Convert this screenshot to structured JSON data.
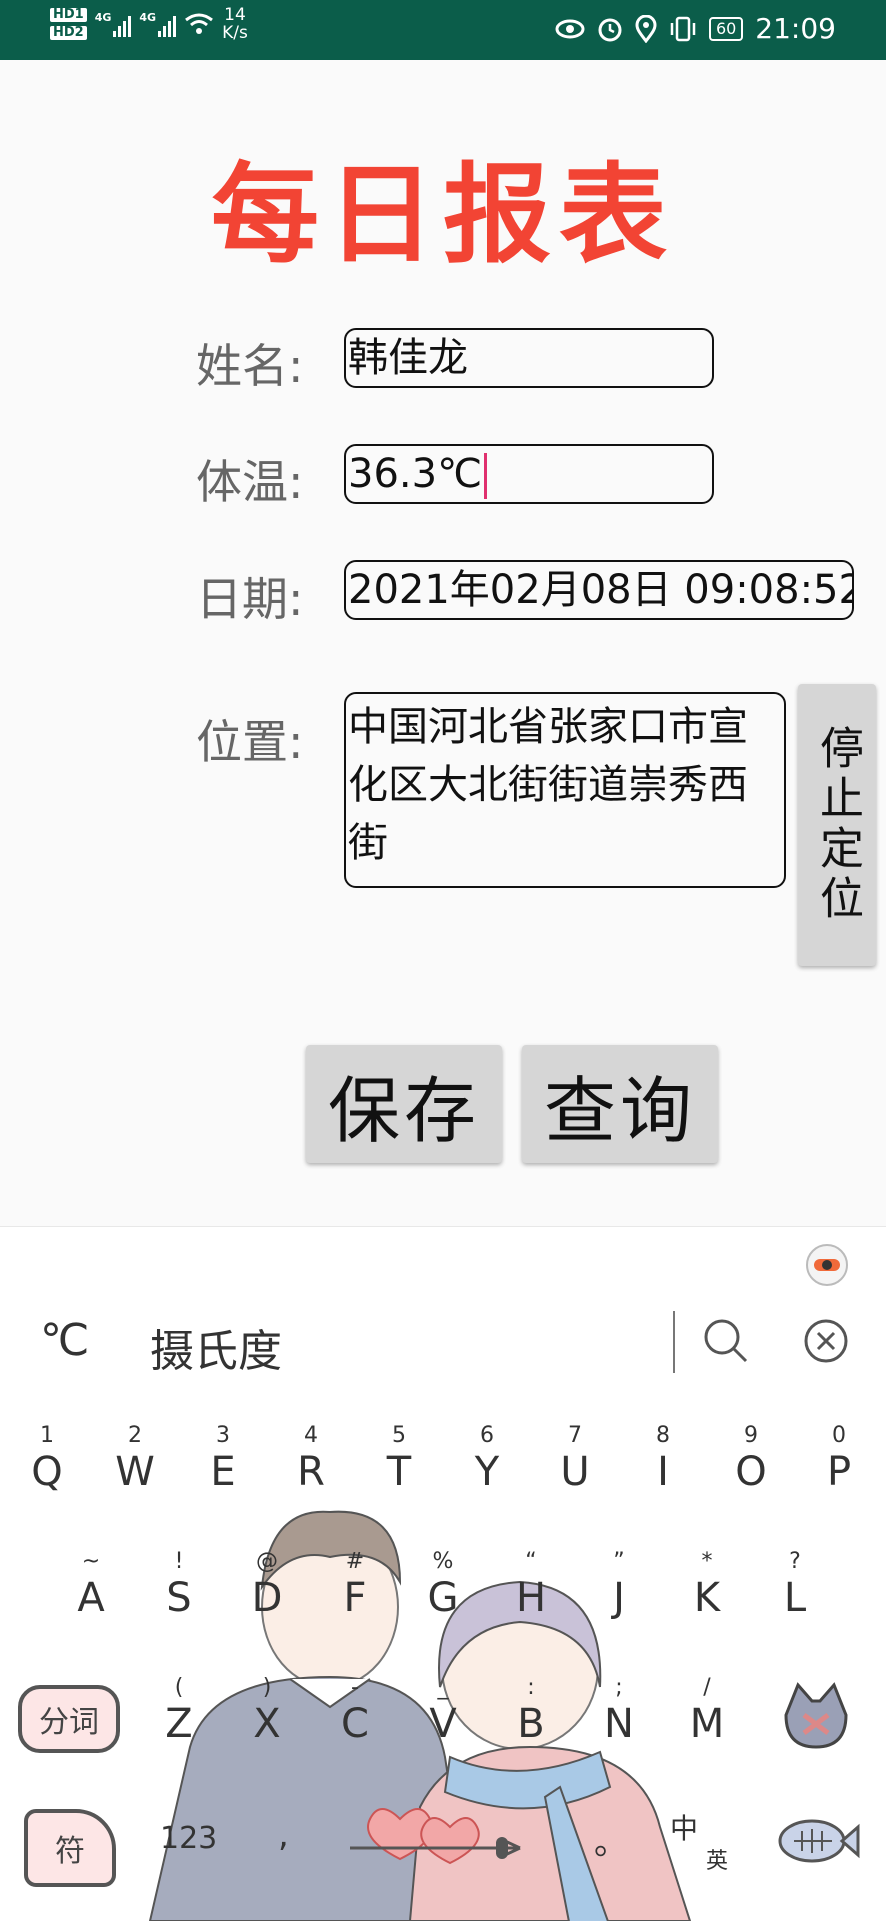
{
  "status_bar": {
    "sim1": "HD1",
    "sim2": "HD2",
    "net1": "4G",
    "net2": "4G",
    "speed_value": "14",
    "speed_unit": "K/s",
    "battery": "60",
    "time": "21:09"
  },
  "page": {
    "title": "每日报表"
  },
  "form": {
    "name_label": "姓名:",
    "name_value": "韩佳龙",
    "temp_label": "体温:",
    "temp_value": "36.3℃",
    "date_label": "日期:",
    "date_value": "2021年02月08日 09:08:52",
    "loc_label": "位置:",
    "loc_value": "中国河北省张家口市宣化区大北街街道崇秀西街",
    "stop_location_label": "停止定位"
  },
  "actions": {
    "save_label": "保存",
    "query_label": "查询"
  },
  "keyboard": {
    "candidates": [
      "℃",
      "摄氏度"
    ],
    "row1": [
      {
        "num": "1",
        "letter": "Q"
      },
      {
        "num": "2",
        "letter": "W"
      },
      {
        "num": "3",
        "letter": "E"
      },
      {
        "num": "4",
        "letter": "R"
      },
      {
        "num": "5",
        "letter": "T"
      },
      {
        "num": "6",
        "letter": "Y"
      },
      {
        "num": "7",
        "letter": "U"
      },
      {
        "num": "8",
        "letter": "I"
      },
      {
        "num": "9",
        "letter": "O"
      },
      {
        "num": "0",
        "letter": "P"
      }
    ],
    "row2": [
      {
        "num": "~",
        "letter": "A"
      },
      {
        "num": "!",
        "letter": "S"
      },
      {
        "num": "@",
        "letter": "D"
      },
      {
        "num": "#",
        "letter": "F"
      },
      {
        "num": "%",
        "letter": "G"
      },
      {
        "num": "“",
        "letter": "H"
      },
      {
        "num": "”",
        "letter": "J"
      },
      {
        "num": "*",
        "letter": "K"
      },
      {
        "num": "?",
        "letter": "L"
      }
    ],
    "row3": [
      {
        "num": "(",
        "letter": "Z"
      },
      {
        "num": ")",
        "letter": "X"
      },
      {
        "num": "-",
        "letter": "C"
      },
      {
        "num": "_",
        "letter": "V"
      },
      {
        "num": ":",
        "letter": "B"
      },
      {
        "num": ";",
        "letter": "N"
      },
      {
        "num": "/",
        "letter": "M"
      }
    ],
    "fenci_label": "分词",
    "fu_label": "符",
    "num_label": "123",
    "comma_label": ",",
    "period_label": "。",
    "zh_label": "中",
    "en_label": "英"
  }
}
